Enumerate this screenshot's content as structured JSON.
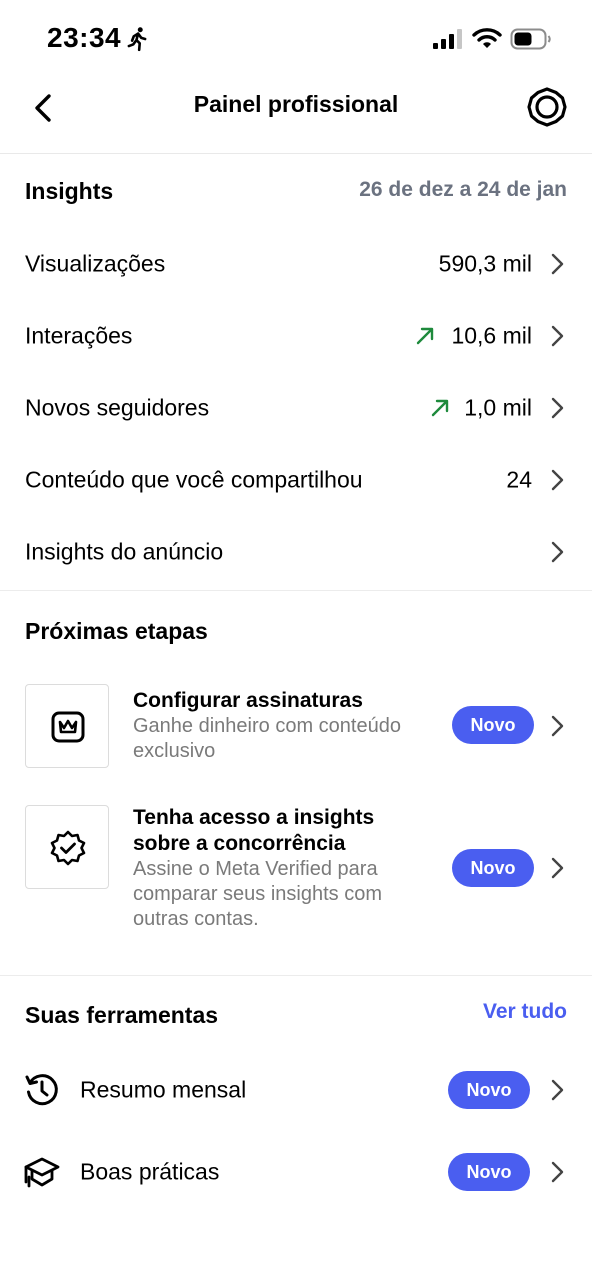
{
  "status_bar": {
    "time": "23:34"
  },
  "header": {
    "title": "Painel profissional"
  },
  "insights": {
    "title": "Insights",
    "date_range": "26 de dez a 24 de jan",
    "rows": [
      {
        "label": "Visualizações",
        "value": "590,3 mil",
        "trend": "none"
      },
      {
        "label": "Interações",
        "value": "10,6 mil",
        "trend": "up"
      },
      {
        "label": "Novos seguidores",
        "value": "1,0 mil",
        "trend": "up"
      },
      {
        "label": "Conteúdo que você compartilhou",
        "value": "24",
        "trend": "none"
      },
      {
        "label": "Insights do anúncio",
        "value": "",
        "trend": "none"
      }
    ]
  },
  "next_steps": {
    "title": "Próximas etapas",
    "items": [
      {
        "title": "Configurar assinaturas",
        "description": "Ganhe dinheiro com conteúdo exclusivo",
        "badge": "Novo",
        "icon": "crown-icon"
      },
      {
        "title": "Tenha acesso a insights sobre a concorrência",
        "description": "Assine o Meta Verified para comparar seus insights com outras contas.",
        "badge": "Novo",
        "icon": "verified-badge-icon"
      }
    ]
  },
  "tools": {
    "title": "Suas ferramentas",
    "view_all": "Ver tudo",
    "items": [
      {
        "label": "Resumo mensal",
        "badge": "Novo",
        "icon": "history-icon"
      },
      {
        "label": "Boas práticas",
        "badge": "Novo",
        "icon": "graduation-cap-icon"
      }
    ]
  },
  "colors": {
    "accent": "#4a5ef0",
    "trend_up": "#1e8a3c",
    "muted": "#7a7a7a"
  }
}
